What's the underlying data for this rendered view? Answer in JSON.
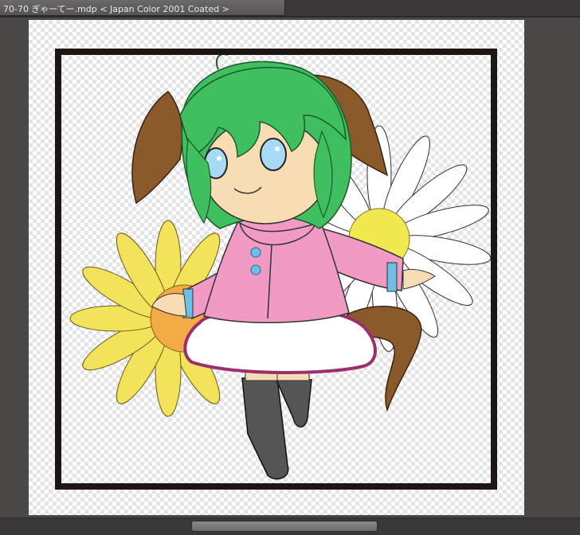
{
  "document": {
    "title": "70-70 ぎゃーてー.mdp < Japan Color 2001 Coated >"
  },
  "colors": {
    "frame": "#1d1514",
    "hair": "#3fbf5f",
    "ears": "#8b5a2b",
    "eyes": "#a7daf5",
    "skin": "#f7dcb4",
    "jacket": "#f09ac4",
    "skirt_trim": "#9b2f6e",
    "stockings": "#555555",
    "sunflower_petals": "#f2e35a",
    "sunflower_center": "#f4aa45",
    "daisy_center": "#f2e94e"
  },
  "scrollbar": {
    "thumb_fraction": 0.32,
    "position_fraction": 0.33
  }
}
